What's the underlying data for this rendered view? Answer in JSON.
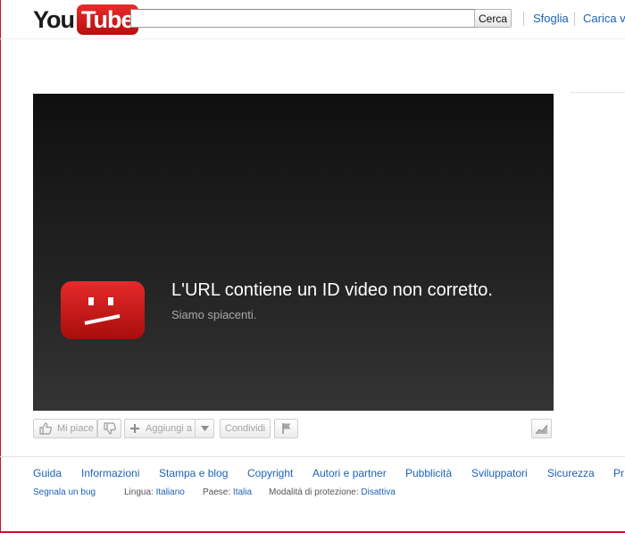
{
  "header": {
    "logo_you": "You",
    "logo_tube": "Tube",
    "search_placeholder": "",
    "search_button": "Cerca",
    "nav": [
      "Sfoglia",
      "Carica vi"
    ]
  },
  "player": {
    "error_title": "L'URL contiene un ID video non corretto.",
    "error_subtitle": "Siamo spiacenti."
  },
  "actions": {
    "like": "Mi piace",
    "add_to": "Aggiungi a",
    "share": "Condividi"
  },
  "footer": {
    "links": [
      "Guida",
      "Informazioni",
      "Stampa e blog",
      "Copyright",
      "Autori e partner",
      "Pubblicità",
      "Sviluppatori",
      "Sicurezza",
      "Pr"
    ],
    "report_bug": "Segnala un bug",
    "language_label": "Lingua:",
    "language_value": "Italiano",
    "country_label": "Paese:",
    "country_value": "Italia",
    "safety_label": "Modalità di protezione:",
    "safety_value": "Disattiva"
  },
  "colors": {
    "brand_red": "#cc181e",
    "link_blue": "#1c62b9",
    "player_bg": "#1a1a1a"
  }
}
